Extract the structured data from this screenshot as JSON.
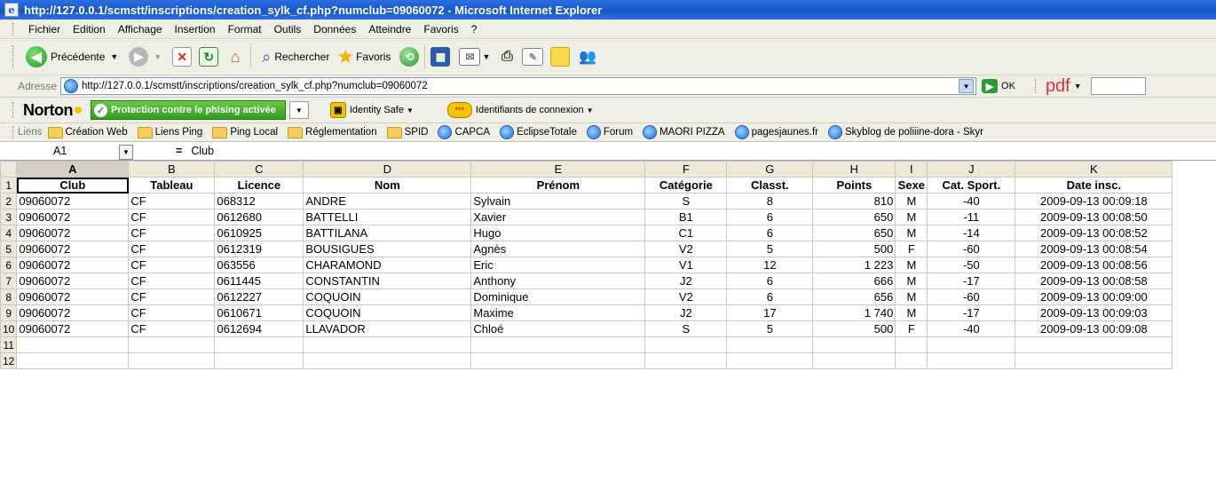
{
  "window": {
    "title": "http://127.0.0.1/scmstt/inscriptions/creation_sylk_cf.php?numclub=09060072 - Microsoft Internet Explorer"
  },
  "menu": [
    "Fichier",
    "Edition",
    "Affichage",
    "Insertion",
    "Format",
    "Outils",
    "Données",
    "Atteindre",
    "Favoris",
    "?"
  ],
  "toolbar": {
    "back": "Précédente",
    "search": "Rechercher",
    "favorites": "Favoris"
  },
  "address": {
    "label": "Adresse",
    "url": "http://127.0.0.1/scmstt/inscriptions/creation_sylk_cf.php?numclub=09060072",
    "go": "OK",
    "pdf": "pdf"
  },
  "norton": {
    "brand": "Norton",
    "protection": "Protection contre le phising activée",
    "identity_safe": "Identity Safe",
    "logins": "Identifiants de connexion"
  },
  "links": {
    "label": "Liens",
    "items": [
      "Création Web",
      "Liens Ping",
      "Ping Local",
      "Réglementation",
      "SPID",
      "CAPCA",
      "EclipseTotale",
      "Forum",
      "MAORI PIZZA",
      "pagesjaunes.fr",
      "Skyblog de poliiine-dora - Skyr"
    ]
  },
  "formula": {
    "cell": "A1",
    "eq": "=",
    "value": "Club"
  },
  "sheet": {
    "columns": [
      "A",
      "B",
      "C",
      "D",
      "E",
      "F",
      "G",
      "H",
      "I",
      "J",
      "K"
    ],
    "rows": [
      "1",
      "2",
      "3",
      "4",
      "5",
      "6",
      "7",
      "8",
      "9",
      "10",
      "11",
      "12"
    ],
    "headers": [
      "Club",
      "Tableau",
      "Licence",
      "Nom",
      "Prénom",
      "Catégorie",
      "Classt.",
      "Points",
      "Sexe",
      "Cat. Sport.",
      "Date insc."
    ],
    "data": [
      [
        "09060072",
        "CF",
        "068312",
        "ANDRE",
        "Sylvain",
        "S",
        "8",
        "810",
        "M",
        "-40",
        "2009-09-13 00:09:18"
      ],
      [
        "09060072",
        "CF",
        "0612680",
        "BATTELLI",
        "Xavier",
        "B1",
        "6",
        "650",
        "M",
        "-11",
        "2009-09-13 00:08:50"
      ],
      [
        "09060072",
        "CF",
        "0610925",
        "BATTILANA",
        "Hugo",
        "C1",
        "6",
        "650",
        "M",
        "-14",
        "2009-09-13 00:08:52"
      ],
      [
        "09060072",
        "CF",
        "0612319",
        "BOUSIGUES",
        "Agnès",
        "V2",
        "5",
        "500",
        "F",
        "-60",
        "2009-09-13 00:08:54"
      ],
      [
        "09060072",
        "CF",
        "063556",
        "CHARAMOND",
        "Eric",
        "V1",
        "12",
        "1 223",
        "M",
        "-50",
        "2009-09-13 00:08:56"
      ],
      [
        "09060072",
        "CF",
        "0611445",
        "CONSTANTIN",
        "Anthony",
        "J2",
        "6",
        "666",
        "M",
        "-17",
        "2009-09-13 00:08:58"
      ],
      [
        "09060072",
        "CF",
        "0612227",
        "COQUOIN",
        "Dominique",
        "V2",
        "6",
        "656",
        "M",
        "-60",
        "2009-09-13 00:09:00"
      ],
      [
        "09060072",
        "CF",
        "0610671",
        "COQUOIN",
        "Maxime",
        "J2",
        "17",
        "1 740",
        "M",
        "-17",
        "2009-09-13 00:09:03"
      ],
      [
        "09060072",
        "CF",
        "0612694",
        "LLAVADOR",
        "Chloé",
        "S",
        "5",
        "500",
        "F",
        "-40",
        "2009-09-13 00:09:08"
      ]
    ]
  }
}
